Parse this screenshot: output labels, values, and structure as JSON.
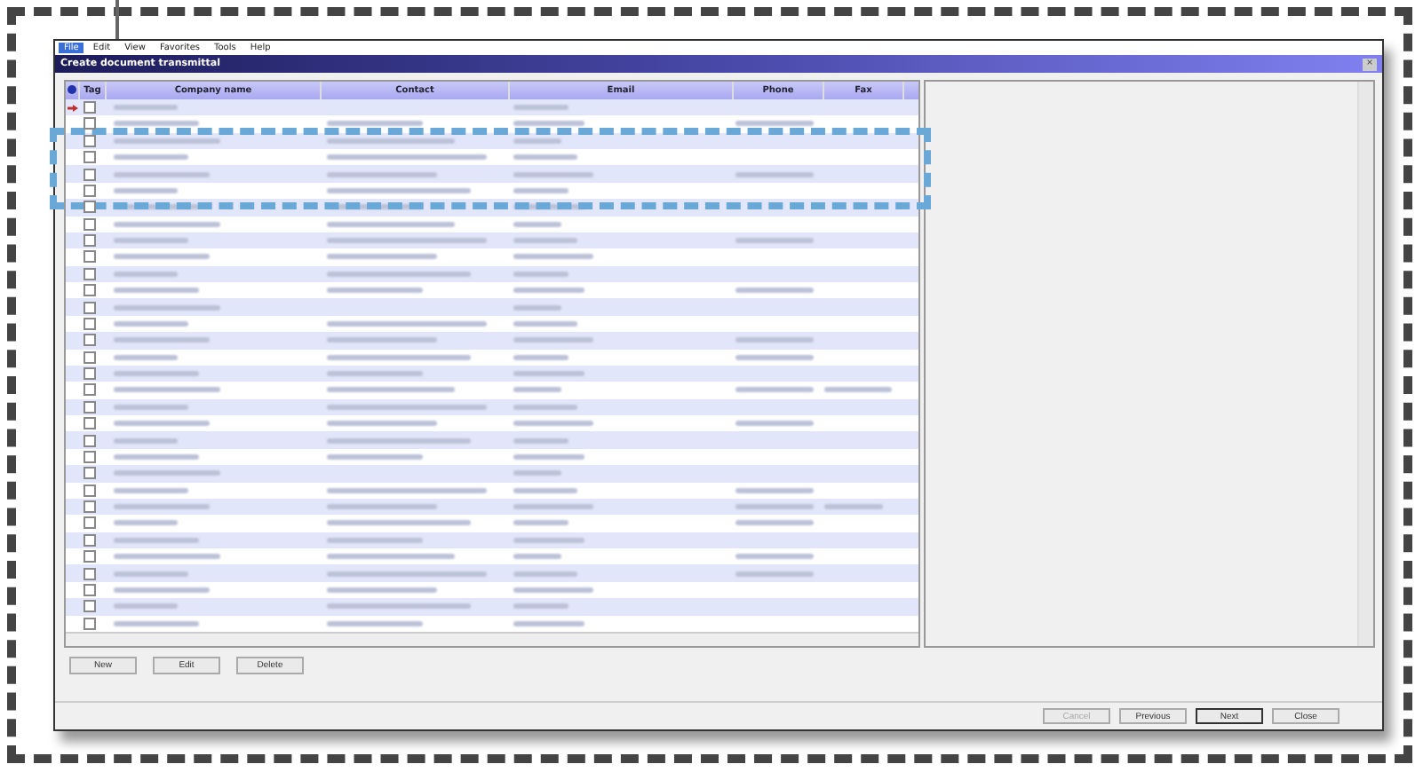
{
  "menu": [
    {
      "label": "File",
      "selected": true
    },
    {
      "label": "Edit",
      "selected": false
    },
    {
      "label": "View",
      "selected": false
    },
    {
      "label": "Favorites",
      "selected": false
    },
    {
      "label": "Tools",
      "selected": false
    },
    {
      "label": "Help",
      "selected": false
    }
  ],
  "window": {
    "title": "Create document transmittal",
    "close": "×"
  },
  "table": {
    "columns": [
      "Tag",
      "Company name",
      "Contact",
      "Email",
      "Phone",
      "Fax"
    ],
    "rows": [
      {
        "current": true,
        "checked": false,
        "filled": [
          true,
          false,
          true,
          false,
          false
        ]
      },
      {
        "current": false,
        "checked": false,
        "filled": [
          true,
          true,
          true,
          true,
          false
        ]
      },
      {
        "current": false,
        "checked": false,
        "filled": [
          true,
          true,
          true,
          false,
          false
        ]
      },
      {
        "current": false,
        "checked": false,
        "filled": [
          true,
          true,
          true,
          false,
          false
        ]
      },
      {
        "current": false,
        "checked": false,
        "filled": [
          true,
          true,
          true,
          true,
          false
        ]
      },
      {
        "current": false,
        "checked": false,
        "filled": [
          true,
          true,
          true,
          false,
          false
        ]
      },
      {
        "current": false,
        "checked": false,
        "filled": [
          true,
          true,
          true,
          false,
          false
        ]
      },
      {
        "current": false,
        "checked": false,
        "filled": [
          true,
          true,
          true,
          false,
          false
        ]
      },
      {
        "current": false,
        "checked": false,
        "filled": [
          true,
          true,
          true,
          true,
          false
        ]
      },
      {
        "current": false,
        "checked": false,
        "filled": [
          true,
          true,
          true,
          false,
          false
        ]
      },
      {
        "current": false,
        "checked": false,
        "filled": [
          true,
          true,
          true,
          false,
          false
        ]
      },
      {
        "current": false,
        "checked": false,
        "filled": [
          true,
          true,
          true,
          true,
          false
        ]
      },
      {
        "current": false,
        "checked": false,
        "filled": [
          true,
          false,
          true,
          false,
          false
        ]
      },
      {
        "current": false,
        "checked": false,
        "filled": [
          true,
          true,
          true,
          false,
          false
        ]
      },
      {
        "current": false,
        "checked": false,
        "filled": [
          true,
          true,
          true,
          true,
          false
        ]
      },
      {
        "current": false,
        "checked": false,
        "filled": [
          true,
          true,
          true,
          true,
          false
        ]
      },
      {
        "current": false,
        "checked": false,
        "filled": [
          true,
          true,
          true,
          false,
          false
        ]
      },
      {
        "current": false,
        "checked": false,
        "filled": [
          true,
          true,
          true,
          true,
          true
        ]
      },
      {
        "current": false,
        "checked": false,
        "filled": [
          true,
          true,
          true,
          false,
          false
        ]
      },
      {
        "current": false,
        "checked": false,
        "filled": [
          true,
          true,
          true,
          true,
          false
        ]
      },
      {
        "current": false,
        "checked": false,
        "filled": [
          true,
          true,
          true,
          false,
          false
        ]
      },
      {
        "current": false,
        "checked": false,
        "filled": [
          true,
          true,
          true,
          false,
          false
        ]
      },
      {
        "current": false,
        "checked": false,
        "filled": [
          true,
          false,
          true,
          false,
          false
        ]
      },
      {
        "current": false,
        "checked": false,
        "filled": [
          true,
          true,
          true,
          true,
          false
        ]
      },
      {
        "current": false,
        "checked": false,
        "filled": [
          true,
          true,
          true,
          true,
          true
        ]
      },
      {
        "current": false,
        "checked": false,
        "filled": [
          true,
          true,
          true,
          true,
          false
        ]
      },
      {
        "current": false,
        "checked": false,
        "filled": [
          true,
          true,
          true,
          false,
          false
        ]
      },
      {
        "current": false,
        "checked": false,
        "filled": [
          true,
          true,
          true,
          true,
          false
        ]
      },
      {
        "current": false,
        "checked": false,
        "filled": [
          true,
          true,
          true,
          true,
          false
        ]
      },
      {
        "current": false,
        "checked": false,
        "filled": [
          true,
          true,
          true,
          false,
          false
        ]
      },
      {
        "current": false,
        "checked": false,
        "filled": [
          true,
          true,
          true,
          false,
          false
        ]
      },
      {
        "current": false,
        "checked": false,
        "filled": [
          true,
          true,
          true,
          false,
          false
        ]
      }
    ]
  },
  "list_buttons": [
    {
      "label": "New"
    },
    {
      "label": "Edit"
    },
    {
      "label": "Delete"
    }
  ],
  "wizard_buttons": [
    {
      "label": "Cancel",
      "disabled": true,
      "default": false
    },
    {
      "label": "Previous",
      "disabled": false,
      "default": false
    },
    {
      "label": "Next",
      "disabled": false,
      "default": true
    },
    {
      "label": "Close",
      "disabled": false,
      "default": false
    }
  ]
}
